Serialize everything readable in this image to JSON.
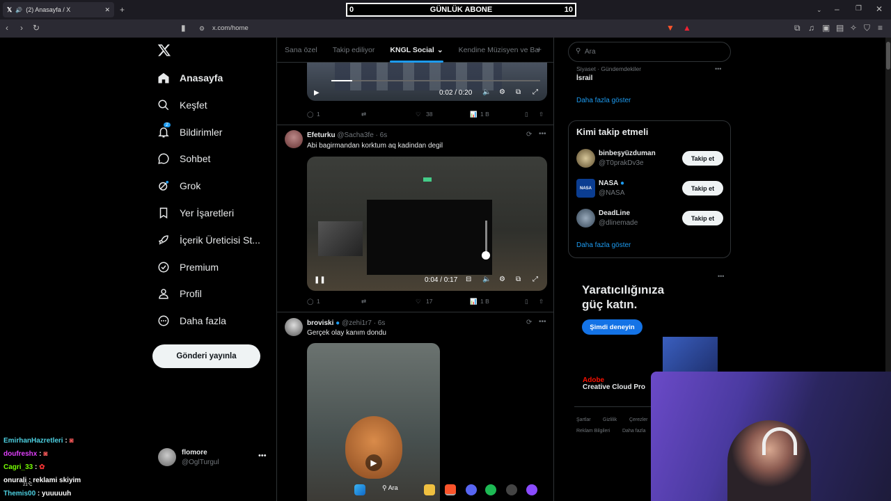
{
  "browser": {
    "tab_title": "(2) Anasayfa / X",
    "url": "x.com/home"
  },
  "overlay": {
    "abone_left": "0",
    "abone_title": "GÜNLÜK ABONE",
    "abone_right": "10"
  },
  "nav": {
    "items": [
      {
        "label": "Anasayfa",
        "icon": "home-icon"
      },
      {
        "label": "Keşfet",
        "icon": "search-icon"
      },
      {
        "label": "Bildirimler",
        "icon": "bell-icon",
        "badge": "2"
      },
      {
        "label": "Sohbet",
        "icon": "chat-bubble-icon"
      },
      {
        "label": "Grok",
        "icon": "grok-icon"
      },
      {
        "label": "Yer İşaretleri",
        "icon": "bookmark-icon"
      },
      {
        "label": "İçerik Üreticisi St...",
        "icon": "rocket-icon"
      },
      {
        "label": "Premium",
        "icon": "verified-icon"
      },
      {
        "label": "Profil",
        "icon": "person-icon"
      },
      {
        "label": "Daha fazla",
        "icon": "more-circle-icon"
      }
    ],
    "post_button": "Gönderi yayınla",
    "account_name": "flomore",
    "account_handle": "@OglTurgul"
  },
  "feed": {
    "tabs": [
      "Sana özel",
      "Takip ediliyor",
      "KNGL Social",
      "Kendine Müzisyen ve Ba"
    ],
    "active_tab": "KNGL Social",
    "post0": {
      "video_time": "0:02 / 0:20",
      "replies": "1",
      "likes": "38",
      "views": "1 B"
    },
    "post1": {
      "name": "Efeturku",
      "handle": "@Sacha3fe · 6s",
      "text": "Abi bagirmandan korktum aq kadindan degil",
      "video_time": "0:04 / 0:17",
      "replies": "1",
      "likes": "17",
      "views": "1 B"
    },
    "post2": {
      "name": "broviski",
      "handle": "@zehi1r7 · 6s",
      "text": "Gerçek olay kanım dondu"
    }
  },
  "right": {
    "search_placeholder": "Ara",
    "trend_meta": "Siyaset · Gündemdekiler",
    "trend_name": "İsrail",
    "show_more_1": "Daha fazla göster",
    "who_to_follow_title": "Kimi takip etmeli",
    "who_to_follow": [
      {
        "name": "binbeşyüzduman",
        "handle": "@T0prakDv3e",
        "button": "Takip et"
      },
      {
        "name": "NASA",
        "handle": "@NASA",
        "button": "Takip et"
      },
      {
        "name": "DeadLine",
        "handle": "@dlinemade",
        "button": "Takip et"
      }
    ],
    "show_more_2": "Daha fazla göster",
    "ad_headline_1": "Yaratıcılığınıza",
    "ad_headline_2": "güç katın.",
    "ad_button": "Şimdi deneyin",
    "ad_brand": "Adobe",
    "ad_product": "Creative Cloud Pro",
    "footer_1": "Şartlar",
    "footer_2": "Gizlilik",
    "footer_3": "Çerezler",
    "footer_4": "Reklam Bilgileri",
    "footer_5": "Daha fazla"
  },
  "chat": [
    {
      "user": "EmirhanHazretleri",
      "msg": "",
      "color": "#4dd0e1"
    },
    {
      "user": "doufreshx",
      "msg": "",
      "color": "#e040fb"
    },
    {
      "user": "Cagri_33",
      "msg": "",
      "color": "#76ff03"
    },
    {
      "user": "onurali",
      "msg": "reklami skiyim",
      "color": "#ffffff"
    },
    {
      "user": "Themis00",
      "msg": "yuuuuuh",
      "color": "#4dd0e1"
    }
  ],
  "taskbar": {
    "search_label": "Ara",
    "weather": "21°C"
  }
}
